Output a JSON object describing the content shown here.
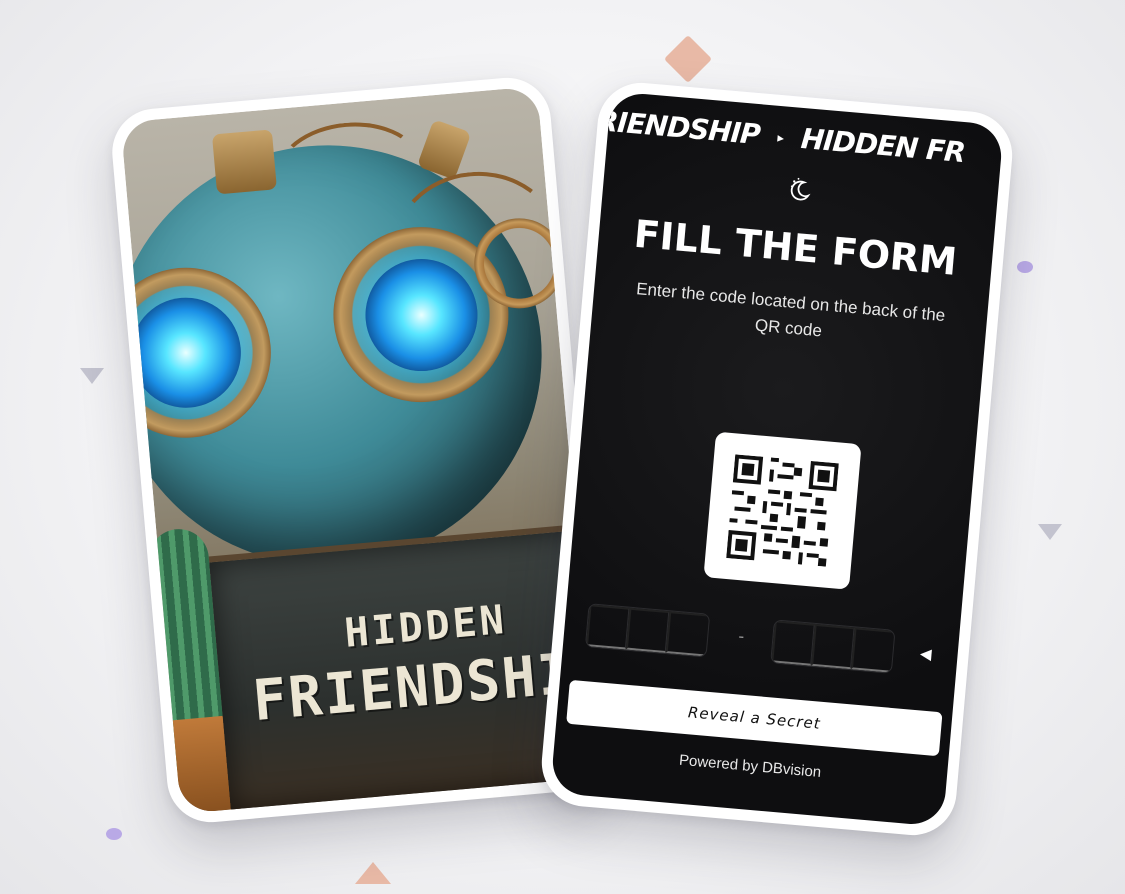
{
  "art_card": {
    "sign_line1": "HIDDEN",
    "sign_line2": "FRIENDSHIP"
  },
  "form_card": {
    "marquee_left": "FRIENDSHIP",
    "marquee_separator": "▸",
    "marquee_right": "HIDDEN FR",
    "moon_icon": "moon-stars-icon",
    "title": "FILL THE FORM",
    "subtitle": "Enter the code located on the back of the QR code",
    "code_separator": "-",
    "code_group_1": [
      "",
      "",
      ""
    ],
    "code_group_2": [
      "",
      "",
      ""
    ],
    "reveal_button": "Reveal a Secret",
    "powered_by": "Powered by DBvision"
  },
  "colors": {
    "background": "#f3f3f5",
    "form_bg": "#0e0e10",
    "accent_peach": "#e8b9a6",
    "accent_lavender": "#b9a9e6",
    "triangle_gray": "#c3c3cf"
  }
}
